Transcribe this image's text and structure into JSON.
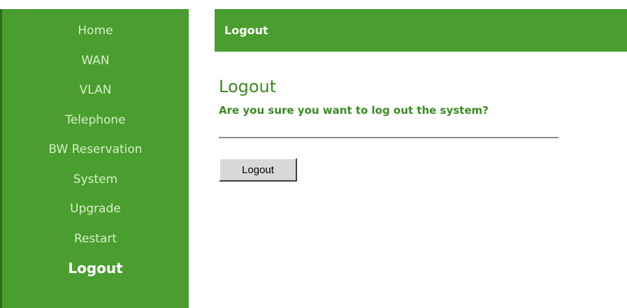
{
  "sidebar": {
    "items": [
      {
        "label": "Home"
      },
      {
        "label": "WAN"
      },
      {
        "label": "VLAN"
      },
      {
        "label": "Telephone"
      },
      {
        "label": "BW Reservation"
      },
      {
        "label": "System"
      },
      {
        "label": "Upgrade"
      },
      {
        "label": "Restart"
      },
      {
        "label": "Logout",
        "active": true
      }
    ]
  },
  "header": {
    "title": "Logout"
  },
  "main": {
    "title": "Logout",
    "confirm_text": "Are you sure you want to log out the system?",
    "logout_button_label": "Logout"
  },
  "colors": {
    "brand_green": "#4a9e2f",
    "title_green": "#3b8a24"
  }
}
